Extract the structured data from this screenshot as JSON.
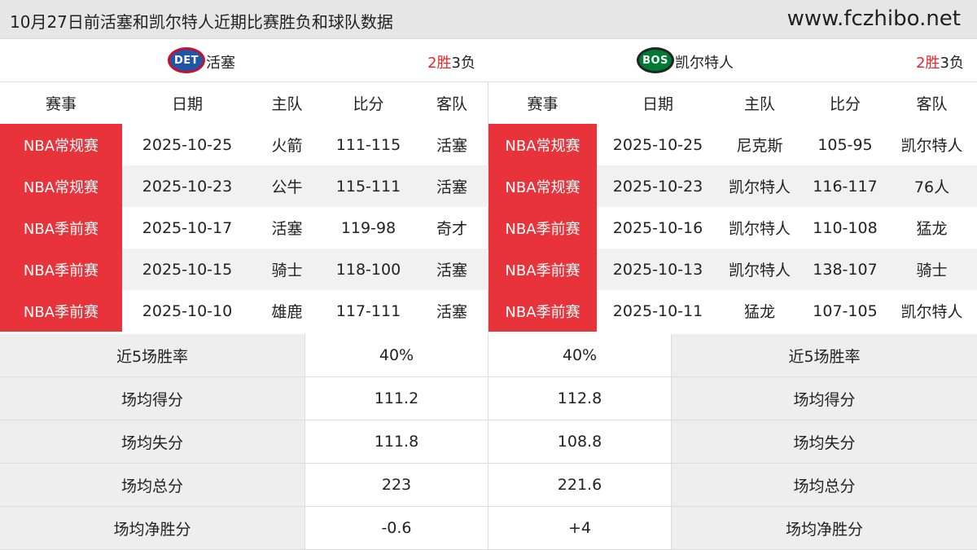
{
  "header": {
    "title": "10月27日前活塞和凯尔特人近期比赛胜负和球队数据",
    "site": "www.fczhibo.net"
  },
  "colors": {
    "event_bg": "#e8333a",
    "win": "#e8262a"
  },
  "left_team": {
    "logo_text": "DET",
    "name": "活塞",
    "wins": "2胜",
    "losses": "3负",
    "columns": [
      "赛事",
      "日期",
      "主队",
      "比分",
      "客队"
    ],
    "games": [
      {
        "event": "NBA常规赛",
        "date": "2025-10-25",
        "home": "火箭",
        "score": "111-115",
        "away": "活塞"
      },
      {
        "event": "NBA常规赛",
        "date": "2025-10-23",
        "home": "公牛",
        "score": "115-111",
        "away": "活塞"
      },
      {
        "event": "NBA季前赛",
        "date": "2025-10-17",
        "home": "活塞",
        "score": "119-98",
        "away": "奇才"
      },
      {
        "event": "NBA季前赛",
        "date": "2025-10-15",
        "home": "骑士",
        "score": "118-100",
        "away": "活塞"
      },
      {
        "event": "NBA季前赛",
        "date": "2025-10-10",
        "home": "雄鹿",
        "score": "117-111",
        "away": "活塞"
      }
    ]
  },
  "right_team": {
    "logo_text": "BOS",
    "name": "凯尔特人",
    "wins": "2胜",
    "losses": "3负",
    "columns": [
      "赛事",
      "日期",
      "主队",
      "比分",
      "客队"
    ],
    "games": [
      {
        "event": "NBA常规赛",
        "date": "2025-10-25",
        "home": "尼克斯",
        "score": "105-95",
        "away": "凯尔特人"
      },
      {
        "event": "NBA常规赛",
        "date": "2025-10-23",
        "home": "凯尔特人",
        "score": "116-117",
        "away": "76人"
      },
      {
        "event": "NBA季前赛",
        "date": "2025-10-16",
        "home": "凯尔特人",
        "score": "110-108",
        "away": "猛龙"
      },
      {
        "event": "NBA季前赛",
        "date": "2025-10-13",
        "home": "凯尔特人",
        "score": "138-107",
        "away": "骑士"
      },
      {
        "event": "NBA季前赛",
        "date": "2025-10-11",
        "home": "猛龙",
        "score": "107-105",
        "away": "凯尔特人"
      }
    ]
  },
  "stats": [
    {
      "label": "近5场胜率",
      "left": "40%",
      "right": "40%"
    },
    {
      "label": "场均得分",
      "left": "111.2",
      "right": "112.8"
    },
    {
      "label": "场均失分",
      "left": "111.8",
      "right": "108.8"
    },
    {
      "label": "场均总分",
      "left": "223",
      "right": "221.6"
    },
    {
      "label": "场均净胜分",
      "left": "-0.6",
      "right": "+4"
    }
  ]
}
